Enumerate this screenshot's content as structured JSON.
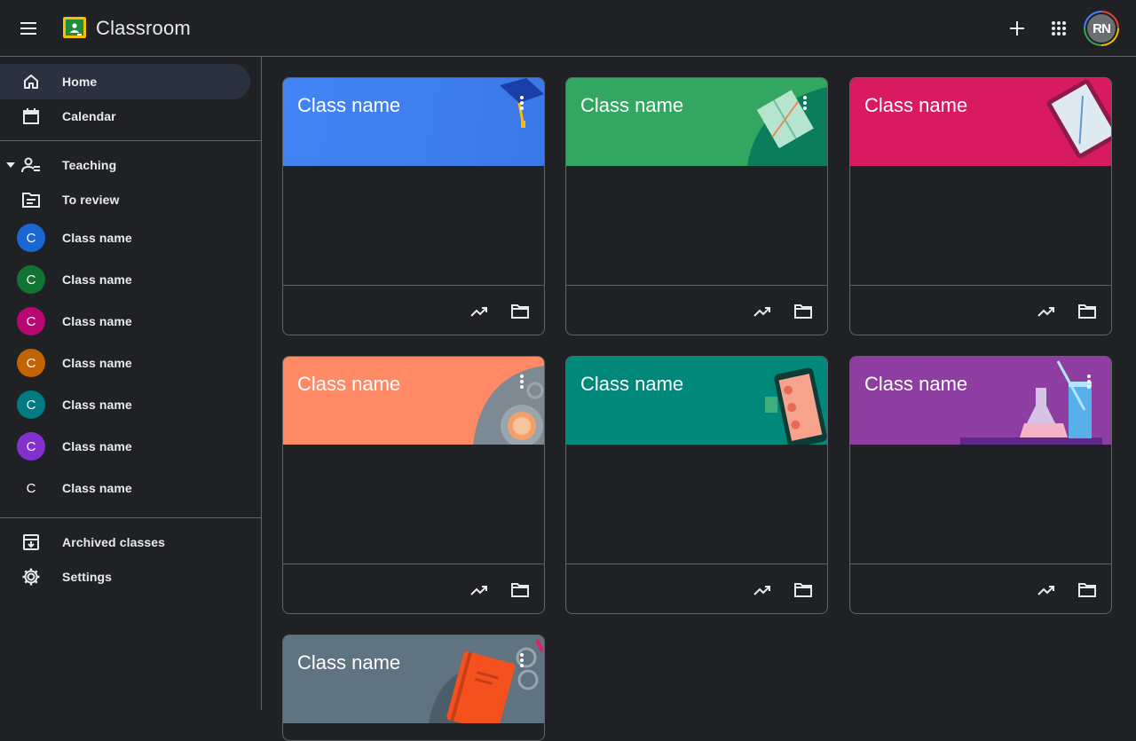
{
  "app": {
    "title": "Classroom"
  },
  "user": {
    "initials": "RN"
  },
  "sidebar": {
    "home": "Home",
    "calendar": "Calendar",
    "teaching": "Teaching",
    "to_review": "To review",
    "classes": [
      {
        "letter": "C",
        "label": "Class name",
        "color": "#1967d2"
      },
      {
        "letter": "C",
        "label": "Class name",
        "color": "#137333"
      },
      {
        "letter": "C",
        "label": "Class name",
        "color": "#b80672"
      },
      {
        "letter": "C",
        "label": "Class name",
        "color": "#c26401"
      },
      {
        "letter": "C",
        "label": "Class name",
        "color": "#007b83"
      },
      {
        "letter": "C",
        "label": "Class name",
        "color": "#8430ce"
      },
      {
        "letter": "C",
        "label": "Class name",
        "color": ""
      }
    ],
    "archived": "Archived classes",
    "settings": "Settings"
  },
  "cards": [
    {
      "title": "Class name",
      "color": "#4285f4",
      "art": "graduation-cap"
    },
    {
      "title": "Class name",
      "color": "#33a661",
      "art": "book"
    },
    {
      "title": "Class name",
      "color": "#d81b60",
      "art": "tablet"
    },
    {
      "title": "Class name",
      "color": "#ff8a65",
      "art": "orange"
    },
    {
      "title": "Class name",
      "color": "#00897b",
      "art": "phone"
    },
    {
      "title": "Class name",
      "color": "#8e3ea0",
      "art": "flask"
    },
    {
      "title": "Class name",
      "color": "#5f7480",
      "art": "notebook"
    }
  ]
}
